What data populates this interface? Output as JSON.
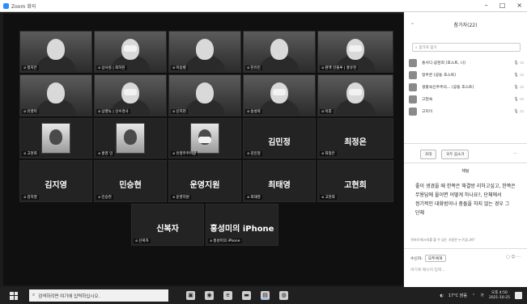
{
  "window": {
    "title": "Zoom 회의",
    "controls": [
      "–",
      "□",
      "×"
    ]
  },
  "grid": {
    "tiles": [
      {
        "name": "정지은",
        "type": "video"
      },
      {
        "name": "상사실 | 최하진",
        "type": "video",
        "mask": true
      },
      {
        "name": "이승렬",
        "type": "video"
      },
      {
        "name": "진유민",
        "type": "video"
      },
      {
        "name": "원엑 인플루 | 홍유진",
        "type": "video",
        "mask": true
      },
      {
        "name": "유영미",
        "type": "video"
      },
      {
        "name": "상명녹 | 신수경사",
        "type": "video",
        "mask": true
      },
      {
        "name": "신지현",
        "type": "video"
      },
      {
        "name": "송성희",
        "type": "video",
        "mask": true
      },
      {
        "name": "이후",
        "type": "video",
        "mask": true
      },
      {
        "name": "고현희",
        "type": "avatar"
      },
      {
        "name": "홍영 민",
        "type": "avatar"
      },
      {
        "name": "유영주주미광",
        "type": "avatar",
        "mask": true
      },
      {
        "name": "김민정",
        "type": "name",
        "label": "김민정"
      },
      {
        "name": "최정은",
        "type": "name",
        "label": "최정은"
      },
      {
        "name": "김지영",
        "type": "name",
        "label": "김지영"
      },
      {
        "name": "민승현",
        "type": "name",
        "label": "민승현"
      },
      {
        "name": "운영지원",
        "type": "name",
        "label": "운영지원"
      },
      {
        "name": "최태영",
        "type": "name",
        "label": "최태영"
      },
      {
        "name": "고현희",
        "type": "name",
        "label": "고현희"
      },
      {
        "name": "신복자",
        "type": "name",
        "label": "신복자"
      },
      {
        "name": "홍성미의 iPhone",
        "type": "name",
        "label": "홍성미의 iPhone"
      }
    ]
  },
  "panel": {
    "participants_title": "참가자(22)",
    "search_placeholder": "참가자 찾기",
    "participants": [
      {
        "name": "홍서디·공현희 (호스트, 나)",
        "icons": "🎙 ▭"
      },
      {
        "name": "정주은 (공동 호스트)",
        "icons": "🎙 ▭"
      },
      {
        "name": "생활속인주주의... (공동 호스트)",
        "icons": "🎙 ▭"
      },
      {
        "name": "고현숙",
        "icons": "🎙 ▭"
      },
      {
        "name": "고지이",
        "icons": "🎙 ▭"
      }
    ],
    "buttons": [
      "초대",
      "모두 음소거"
    ],
    "more": "...",
    "chat_title": "채팅",
    "chat_message": "좋이 생겼을 때 한쪽은 해결방 리하고싶고, 한쪽은 무용답에 올이면 어떻게 하나요?, 단체에서 정기적인 대화범이나 충돌을 하지 않는 경우 그 단체",
    "chat_note": "귀하의 메시지를 볼 수 있는 사람은 누구입니까?",
    "chat_to_label": "수신자:",
    "chat_to_value": "모두에게",
    "chat_tools": "▢ ☺ ···",
    "chat_input_placeholder": "여기에 메시지 입력..."
  },
  "taskbar": {
    "search_placeholder": "검색하려면 여기에 입력하십시오.",
    "weather": "17°C 맑음",
    "lang": "가",
    "time": "오후 4:50",
    "date": "2021-10-25"
  }
}
